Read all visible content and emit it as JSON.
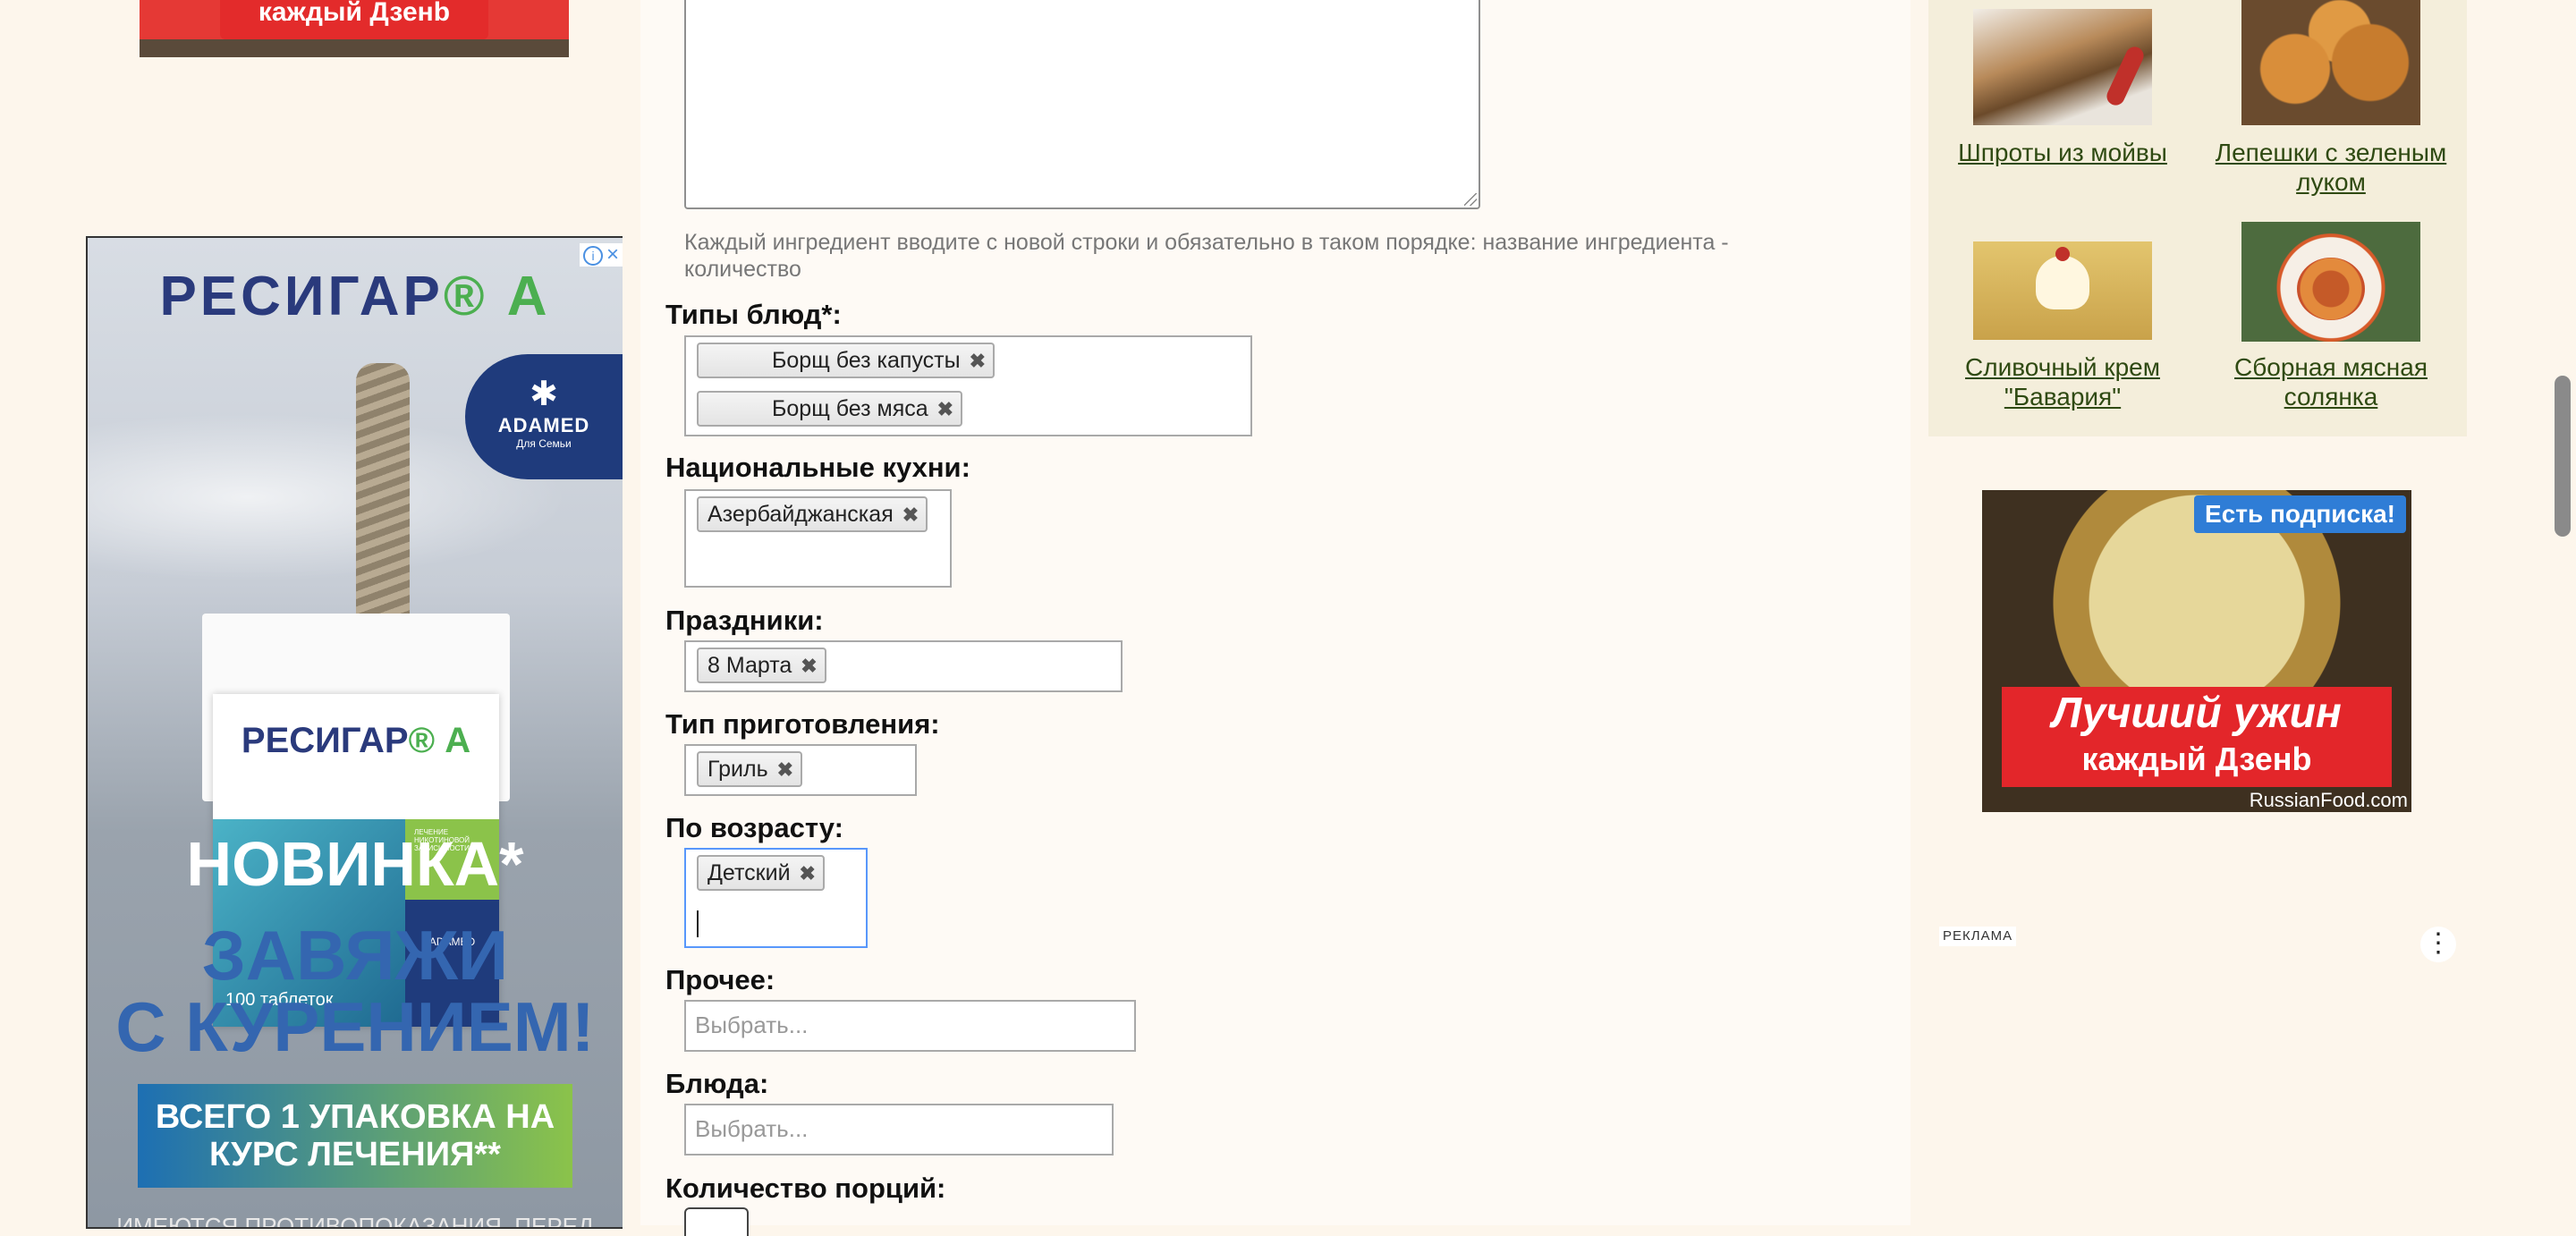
{
  "top_ad": {
    "text": "каждый Дзенb"
  },
  "left_ad": {
    "brand": "РЕСИГАР",
    "brand_suffix": "® А",
    "adamed": "ADAMED",
    "adamed_sub": "Для Семьи",
    "pack_brand": "РЕСИГАР",
    "pack_brand_suffix": "® А",
    "pack_count": "100 таблеток",
    "pack_green_text": "ЛЕЧЕНИЕ НИКОТИНОВОЙ ЗАВИСИМОСТИ",
    "pack_navy_text": "ADAMED",
    "novinka": "НОВИНКА*",
    "slogan_line1": "ЗАВЯЖИ",
    "slogan_line2": "С КУРЕНИЕМ!",
    "course": "ВСЕГО 1 УПАКОВКА НА КУРС ЛЕЧЕНИЯ**",
    "fine_print": "ИМЕЮТСЯ ПРОТИВОПОКАЗАНИЯ. ПЕРЕД"
  },
  "form": {
    "ingredients_hint": "Каждый ингредиент вводите с новой строки и обязательно в таком порядке: название ингредиента - количество",
    "dish_types": {
      "label": "Типы блюд*:",
      "tags": [
        "Борщ без капусты",
        "Борщ без мяса"
      ]
    },
    "cuisines": {
      "label": "Национальные кухни:",
      "tags": [
        "Азербайджанская"
      ]
    },
    "holidays": {
      "label": "Праздники:",
      "tags": [
        "8 Марта"
      ]
    },
    "cooking_type": {
      "label": "Тип приготовления:",
      "tags": [
        "Гриль"
      ]
    },
    "age": {
      "label": "По возрасту:",
      "tags": [
        "Детский"
      ]
    },
    "other": {
      "label": "Прочее:",
      "placeholder": "Выбрать..."
    },
    "dishes": {
      "label": "Блюда:",
      "placeholder": "Выбрать..."
    },
    "portions": {
      "label": "Количество порций:"
    },
    "remove_symbol": "✖"
  },
  "recipes": [
    {
      "title": "Шпроты из мойвы"
    },
    {
      "title": "Лепешки с зеленым луком"
    },
    {
      "title": "Сливочный крем \"Бавария\""
    },
    {
      "title": "Сборная мясная солянка"
    }
  ],
  "promo": {
    "badge": "Есть подписка!",
    "line1": "Лучший ужин",
    "line2": "каждый Дзенb",
    "watermark": "RussianFood.com"
  },
  "ad_label": "РЕКЛАМА",
  "colors": {
    "link": "#2f4a12",
    "focus_border": "#5897fb",
    "page_bg": "#fdf6ec"
  }
}
